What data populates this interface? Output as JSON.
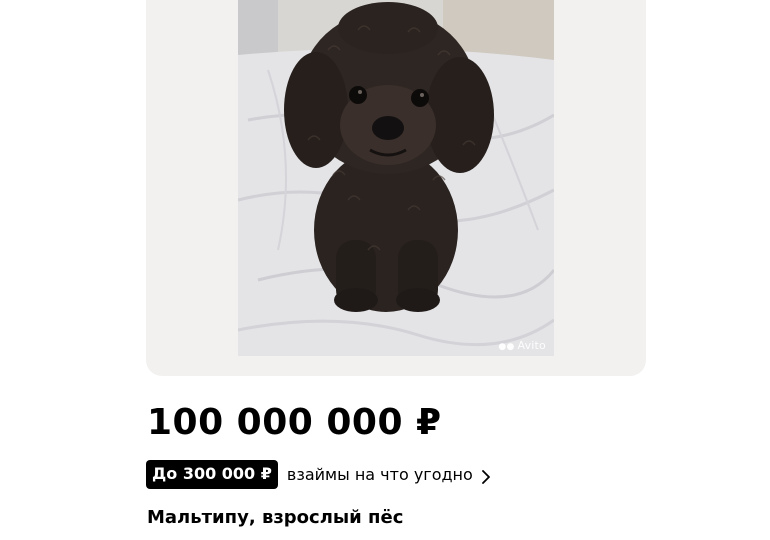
{
  "listing": {
    "photo": {
      "subject": "dog-photo",
      "watermark": "Avito"
    },
    "price": "100 000 000 ₽",
    "loan": {
      "badge": "До 300 000 ₽",
      "text": "взаймы на что угодно",
      "icon": "chevron-right-icon"
    },
    "title": "Мальтипу, взрослый пёс"
  },
  "colors": {
    "gallery_bg": "#f2f1f0",
    "badge_bg": "#000000",
    "badge_text": "#ffffff",
    "text": "#000000"
  }
}
